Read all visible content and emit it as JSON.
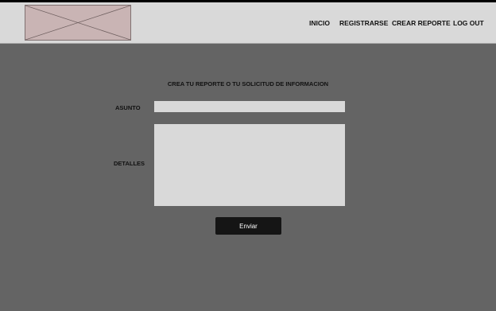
{
  "header": {
    "logo": "placeholder-image",
    "nav": [
      {
        "label": "INICIO"
      },
      {
        "label": "REGISTRARSE"
      },
      {
        "label": "CREAR REPORTE"
      },
      {
        "label": "LOG OUT"
      }
    ]
  },
  "form": {
    "title": "CREA TU REPORTE O TU SOLICITUD DE INFORMACION",
    "subject_label": "ASUNTO",
    "subject_value": "",
    "details_label": "DETALLES",
    "details_value": "",
    "submit_label": "Enviar"
  },
  "colors": {
    "header_bg": "#d9d9d9",
    "page_bg": "#646464",
    "field_bg": "#d9d9d9",
    "button_bg": "#151515",
    "logo_bg": "#c9b4b4"
  }
}
